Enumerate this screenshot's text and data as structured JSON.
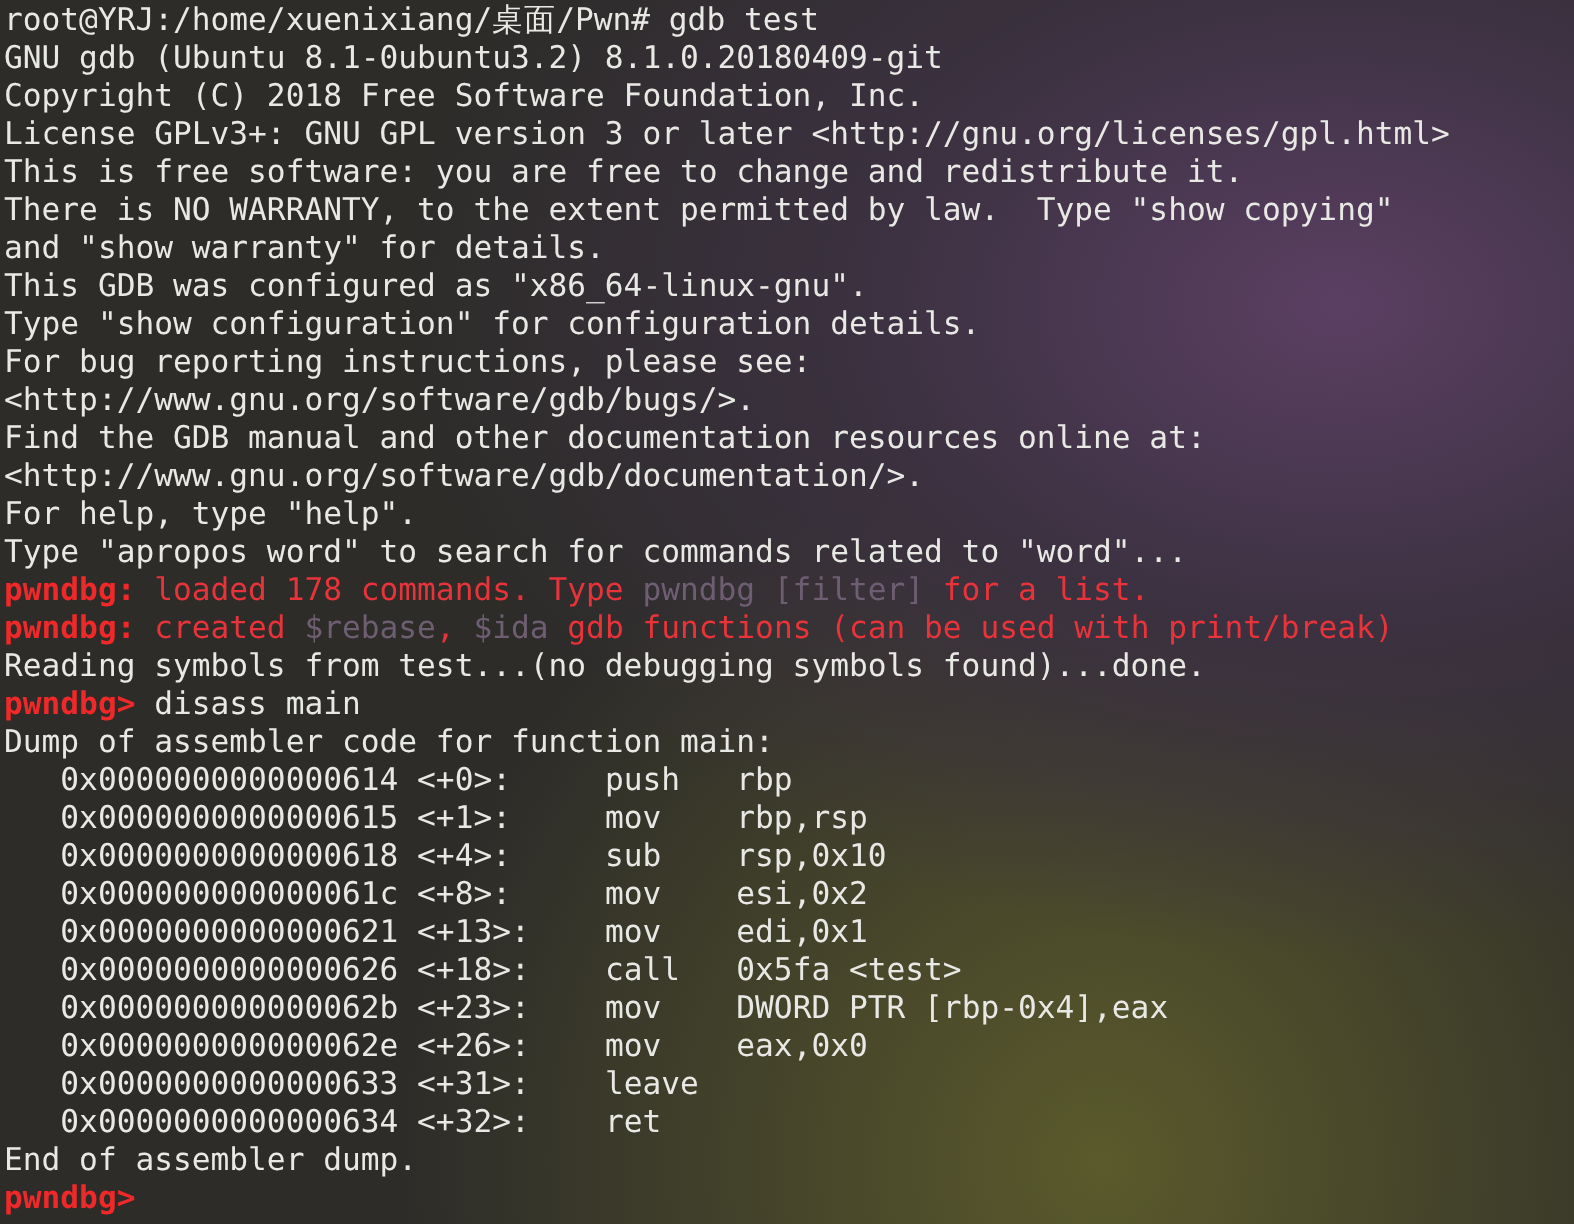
{
  "terminal": {
    "lines": [
      [
        {
          "kind": "plain",
          "text": "root@YRJ:/home/xuenixiang/桌面/Pwn# gdb test"
        }
      ],
      [
        {
          "kind": "plain",
          "text": "GNU gdb (Ubuntu 8.1-0ubuntu3.2) 8.1.0.20180409-git"
        }
      ],
      [
        {
          "kind": "plain",
          "text": "Copyright (C) 2018 Free Software Foundation, Inc."
        }
      ],
      [
        {
          "kind": "plain",
          "text": "License GPLv3+: GNU GPL version 3 or later <http://gnu.org/licenses/gpl.html>"
        }
      ],
      [
        {
          "kind": "plain",
          "text": "This is free software: you are free to change and redistribute it."
        }
      ],
      [
        {
          "kind": "plain",
          "text": "There is NO WARRANTY, to the extent permitted by law.  Type \"show copying\""
        }
      ],
      [
        {
          "kind": "plain",
          "text": "and \"show warranty\" for details."
        }
      ],
      [
        {
          "kind": "plain",
          "text": "This GDB was configured as \"x86_64-linux-gnu\"."
        }
      ],
      [
        {
          "kind": "plain",
          "text": "Type \"show configuration\" for configuration details."
        }
      ],
      [
        {
          "kind": "plain",
          "text": "For bug reporting instructions, please see:"
        }
      ],
      [
        {
          "kind": "plain",
          "text": "<http://www.gnu.org/software/gdb/bugs/>."
        }
      ],
      [
        {
          "kind": "plain",
          "text": "Find the GDB manual and other documentation resources online at:"
        }
      ],
      [
        {
          "kind": "plain",
          "text": "<http://www.gnu.org/software/gdb/documentation/>."
        }
      ],
      [
        {
          "kind": "plain",
          "text": "For help, type \"help\"."
        }
      ],
      [
        {
          "kind": "plain",
          "text": "Type \"apropos word\" to search for commands related to \"word\"..."
        }
      ],
      [
        {
          "kind": "prompt",
          "text": "pwndbg:"
        },
        {
          "kind": "error",
          "text": " loaded 178 commands. Type "
        },
        {
          "kind": "dim",
          "text": "pwndbg [filter]"
        },
        {
          "kind": "error",
          "text": " for a list."
        }
      ],
      [
        {
          "kind": "prompt",
          "text": "pwndbg:"
        },
        {
          "kind": "error",
          "text": " created "
        },
        {
          "kind": "dim",
          "text": "$rebase"
        },
        {
          "kind": "error",
          "text": ", "
        },
        {
          "kind": "dim",
          "text": "$ida"
        },
        {
          "kind": "error",
          "text": " gdb functions (can be used with print/break)"
        }
      ],
      [
        {
          "kind": "plain",
          "text": "Reading symbols from test...(no debugging symbols found)...done."
        }
      ],
      [
        {
          "kind": "prompt",
          "text": "pwndbg>"
        },
        {
          "kind": "plain",
          "text": " disass main"
        }
      ],
      [
        {
          "kind": "plain",
          "text": "Dump of assembler code for function main:"
        }
      ],
      [
        {
          "kind": "plain",
          "text": "   0x0000000000000614 <+0>:\tpush   rbp"
        }
      ],
      [
        {
          "kind": "plain",
          "text": "   0x0000000000000615 <+1>:\tmov    rbp,rsp"
        }
      ],
      [
        {
          "kind": "plain",
          "text": "   0x0000000000000618 <+4>:\tsub    rsp,0x10"
        }
      ],
      [
        {
          "kind": "plain",
          "text": "   0x000000000000061c <+8>:\tmov    esi,0x2"
        }
      ],
      [
        {
          "kind": "plain",
          "text": "   0x0000000000000621 <+13>:\tmov    edi,0x1"
        }
      ],
      [
        {
          "kind": "plain",
          "text": "   0x0000000000000626 <+18>:\tcall   0x5fa <test>"
        }
      ],
      [
        {
          "kind": "plain",
          "text": "   0x000000000000062b <+23>:\tmov    DWORD PTR [rbp-0x4],eax"
        }
      ],
      [
        {
          "kind": "plain",
          "text": "   0x000000000000062e <+26>:\tmov    eax,0x0"
        }
      ],
      [
        {
          "kind": "plain",
          "text": "   0x0000000000000633 <+31>:\tleave"
        }
      ],
      [
        {
          "kind": "plain",
          "text": "   0x0000000000000634 <+32>:\tret"
        }
      ],
      [
        {
          "kind": "plain",
          "text": "End of assembler dump."
        }
      ],
      [
        {
          "kind": "prompt",
          "text": "pwndbg>"
        }
      ]
    ]
  }
}
